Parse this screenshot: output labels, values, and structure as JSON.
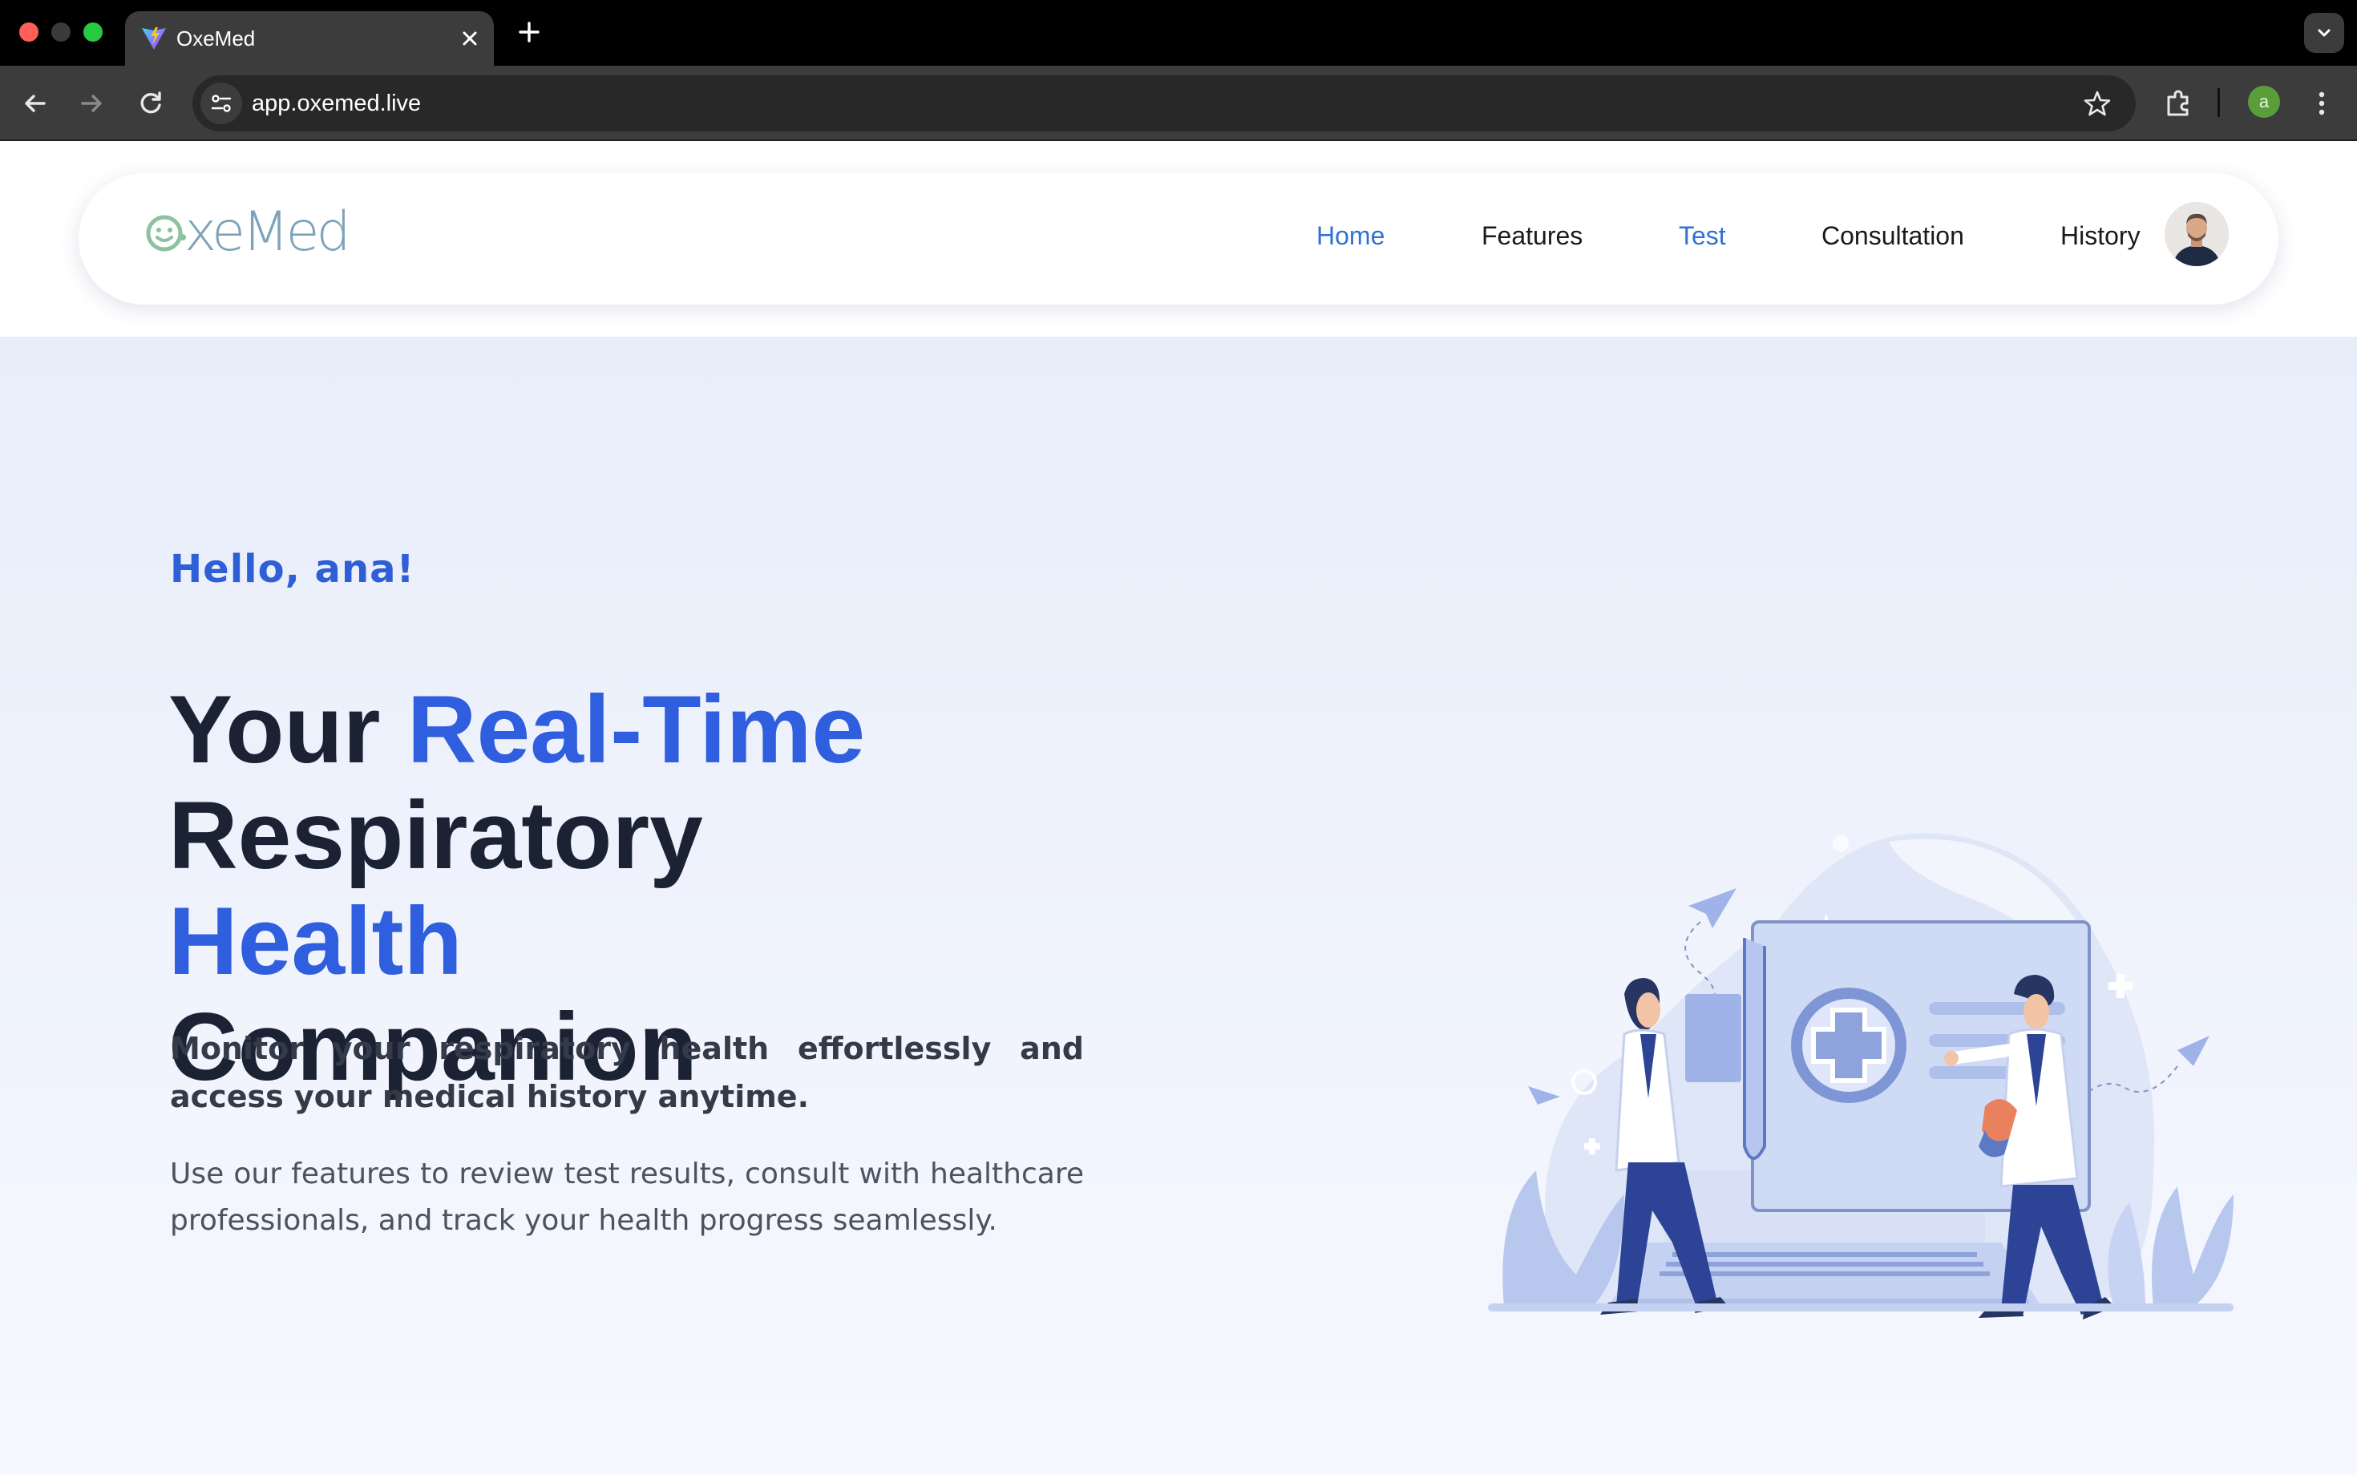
{
  "browser": {
    "tab_title": "OxeMed",
    "url": "app.oxemed.live",
    "profile_initial": "a"
  },
  "nav": {
    "logo_text": "xeMed",
    "items": [
      {
        "label": "Home",
        "active": true
      },
      {
        "label": "Features",
        "active": false
      },
      {
        "label": "Test",
        "active": true
      },
      {
        "label": "Consultation",
        "active": false
      },
      {
        "label": "History",
        "active": false
      }
    ]
  },
  "hero": {
    "greeting": "Hello, ana!",
    "headline": {
      "part1": "Your ",
      "part2": "Real-Time",
      "part3": "Respiratory ",
      "part4": "Health",
      "part5": "Companion"
    },
    "lead": "Monitor your respiratory health effortlessly and access your medical history anytime.",
    "body": "Use our features to review test results, consult with healthcare professionals, and track your health progress seamlessly."
  },
  "colors": {
    "accent": "#2f5ede",
    "nav_active": "#2f72d4",
    "logo": "#7ea2b8",
    "heading": "#1b2234",
    "page_bg": "#f0f3fc"
  },
  "icons": [
    "back-arrow-icon",
    "forward-arrow-icon",
    "reload-icon",
    "site-info-icon",
    "star-icon",
    "extensions-icon",
    "menu-dots-icon",
    "close-icon",
    "plus-icon",
    "chevron-down-icon"
  ]
}
